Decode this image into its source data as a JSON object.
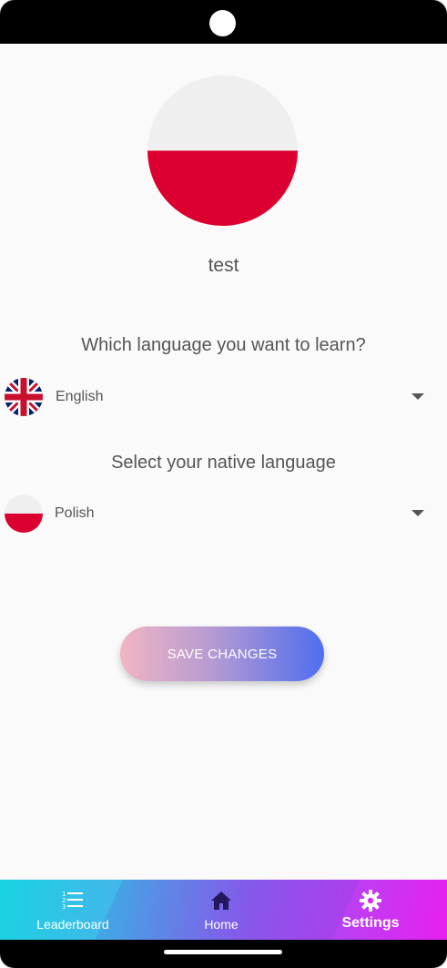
{
  "profile": {
    "username": "test"
  },
  "learn_language": {
    "question": "Which language you want to learn?",
    "selected": "English",
    "flag_icon": "uk-flag-icon"
  },
  "native_language": {
    "question": "Select your native language",
    "selected": "Polish",
    "flag_icon": "poland-flag-icon"
  },
  "actions": {
    "save_label": "SAVE CHANGES"
  },
  "bottom_nav": {
    "items": [
      {
        "label": "Leaderboard",
        "icon": "list-icon"
      },
      {
        "label": "Home",
        "icon": "home-icon"
      },
      {
        "label": "Settings",
        "icon": "gear-icon",
        "active": true
      }
    ]
  },
  "colors": {
    "polish_white": "#efefef",
    "polish_red": "#dc0030",
    "button_gradient_start": "#f2b5c3",
    "button_gradient_end": "#4f6ef0",
    "nav_gradient_start": "#19d3e0",
    "nav_gradient_end": "#e81ff0"
  }
}
